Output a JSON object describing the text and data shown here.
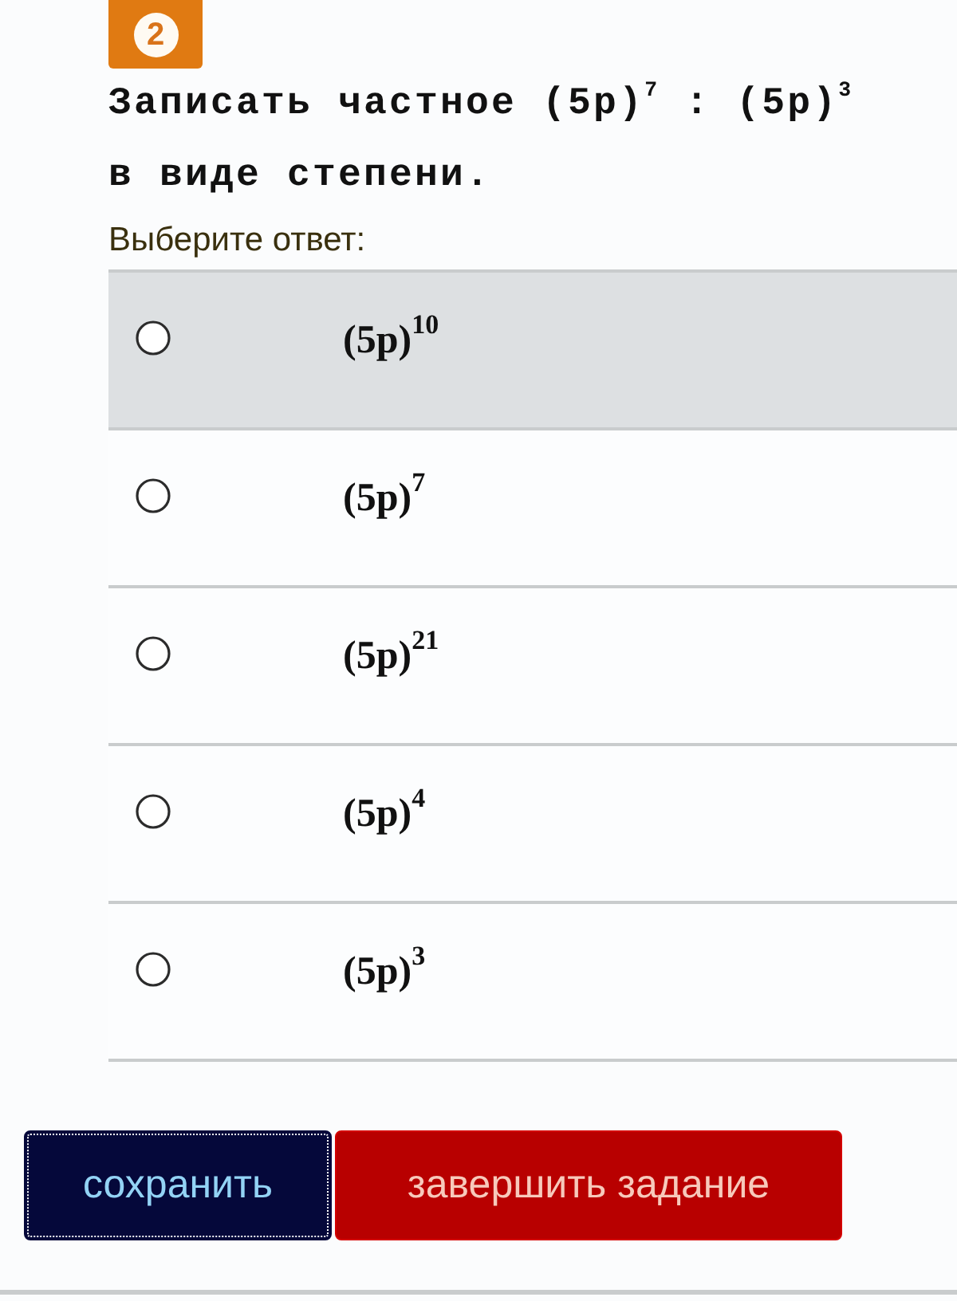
{
  "badge": {
    "number": "2"
  },
  "question": "Записать частное (5p)$^{7}$ : (5p)$^{3}$ в виде степени.",
  "prompt": "Выберите ответ:",
  "options": [
    {
      "text": "(5p)$^{10}$",
      "selected": false,
      "highlighted": true
    },
    {
      "text": "(5p)$^{7}$",
      "selected": false,
      "highlighted": false
    },
    {
      "text": "(5p)$^{21}$",
      "selected": false,
      "highlighted": false
    },
    {
      "text": "(5p)$^{4}$",
      "selected": false,
      "highlighted": false
    },
    {
      "text": "(5p)$^{3}$",
      "selected": false,
      "highlighted": false
    }
  ],
  "buttons": [
    {
      "label": "сохранить",
      "kind": "save",
      "focused": true
    },
    {
      "label": "завершить задание",
      "kind": "finish",
      "focused": false
    }
  ]
}
